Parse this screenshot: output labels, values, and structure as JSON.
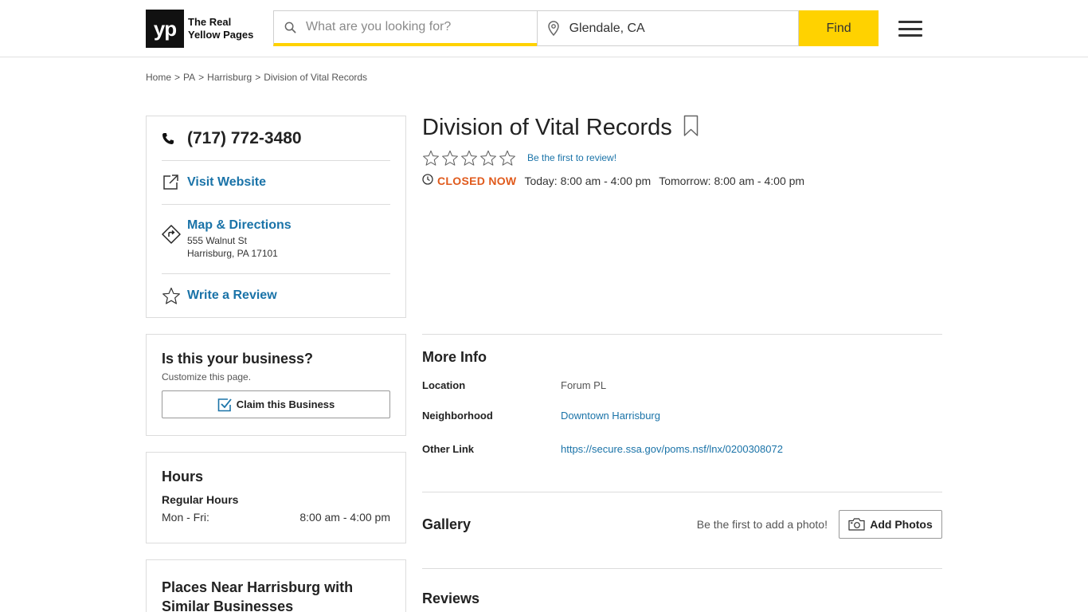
{
  "header": {
    "logo_mark": "yp",
    "logo_line1": "The Real",
    "logo_line2": "Yellow Pages",
    "search_placeholder": "What are you looking for?",
    "location_value": "Glendale, CA",
    "find_label": "Find"
  },
  "breadcrumb": [
    "Home",
    "PA",
    "Harrisburg",
    "Division of Vital Records"
  ],
  "contact": {
    "phone": "(717) 772-3480",
    "visit_website": "Visit Website",
    "map_directions": "Map & Directions",
    "address_line1": "555 Walnut St",
    "address_line2": "Harrisburg, PA 17101",
    "write_review": "Write a Review"
  },
  "claim": {
    "title": "Is this your business?",
    "subtitle": "Customize this page.",
    "button": "Claim this Business"
  },
  "hours_card": {
    "title": "Hours",
    "subtitle": "Regular Hours",
    "days": "Mon - Fri:",
    "time": "8:00 am - 4:00 pm"
  },
  "places": {
    "title_line1": "Places Near Harrisburg with",
    "title_line2": "Similar Businesses"
  },
  "business": {
    "name": "Division of Vital Records",
    "first_review": "Be the first to review!",
    "rating": 0,
    "status": "CLOSED NOW",
    "today": "Today: 8:00 am - 4:00 pm",
    "tomorrow": "Tomorrow: 8:00 am - 4:00 pm"
  },
  "more_info": {
    "title": "More Info",
    "location_label": "Location",
    "location_value": "Forum PL",
    "neighborhood_label": "Neighborhood",
    "neighborhood_value": "Downtown Harrisburg",
    "other_link_label": "Other Link",
    "other_link_value": "https://secure.ssa.gov/poms.nsf/lnx/0200308072"
  },
  "gallery": {
    "title": "Gallery",
    "note": "Be the first to add a photo!",
    "button": "Add Photos"
  },
  "reviews": {
    "title": "Reviews"
  },
  "colors": {
    "brand_yellow": "#ffd200",
    "link_blue": "#1a73a8",
    "closed_orange": "#e05a1c"
  }
}
